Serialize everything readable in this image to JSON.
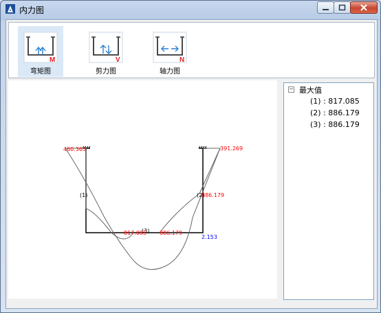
{
  "window": {
    "title": "内力图"
  },
  "toolbar": {
    "buttons": [
      {
        "label": "弯矩图",
        "icon": "bending-moment-icon",
        "badge": "M",
        "selected": true
      },
      {
        "label": "剪力图",
        "icon": "shear-force-icon",
        "badge": "V",
        "selected": false
      },
      {
        "label": "轴力图",
        "icon": "axial-force-icon",
        "badge": "N",
        "selected": false
      }
    ]
  },
  "diagram": {
    "member_labels": [
      "(1)",
      "(2)",
      "(3)"
    ],
    "values": {
      "top_left": "460.365",
      "top_right": "391.269",
      "right_mid": "886.179",
      "beam_left": "817.085",
      "beam_right": "886.179",
      "corner": "2.153"
    }
  },
  "tree": {
    "header": "最大值",
    "items": [
      "(1) : 817.085",
      "(2) : 886.179",
      "(3) : 886.179"
    ]
  },
  "colors": {
    "values_red": "#ff0000",
    "value_blue": "#0000ff",
    "badge": "#e02020",
    "selection": "#dbe9f7"
  }
}
